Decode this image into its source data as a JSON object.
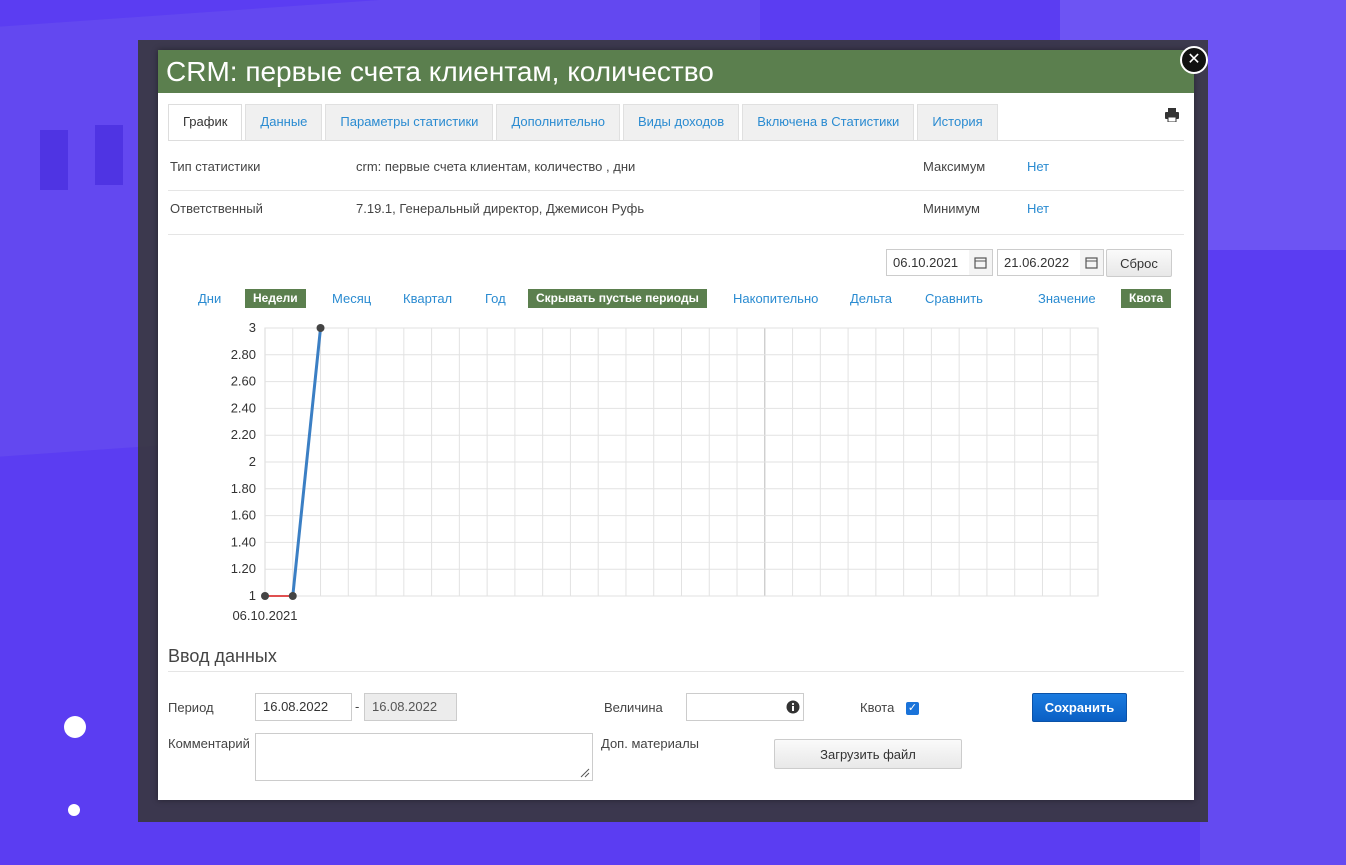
{
  "window": {
    "title": "CRM: первые счета клиентам, количество"
  },
  "tabs": [
    {
      "label": "График",
      "active": true
    },
    {
      "label": "Данные"
    },
    {
      "label": "Параметры статистики"
    },
    {
      "label": "Дополнительно"
    },
    {
      "label": "Виды доходов"
    },
    {
      "label": "Включена в Статистики"
    },
    {
      "label": "История"
    }
  ],
  "icons": {
    "close": "close-icon",
    "print": "printer-icon",
    "calendar": "calendar-icon",
    "info": "info-icon"
  },
  "info": {
    "type_label": "Тип статистики",
    "type_value": "crm: первые счета клиентам, количество , дни",
    "max_label": "Максимум",
    "max_value": "Нет",
    "owner_label": "Ответственный",
    "owner_value": "7.19.1, Генеральный директор, Джемисон Руфь",
    "min_label": "Минимум",
    "min_value": "Нет"
  },
  "range": {
    "from": "06.10.2021",
    "to": "21.06.2022",
    "reset_label": "Сброс"
  },
  "periods": {
    "days": "Дни",
    "weeks": "Недели",
    "month": "Месяц",
    "quarter": "Квартал",
    "year": "Год",
    "hide_empty": "Скрывать пустые периоды",
    "cumulative": "Накопительно",
    "delta": "Дельта",
    "compare": "Сравнить",
    "value": "Значение",
    "quota": "Квота"
  },
  "chart_data": {
    "type": "line",
    "y_ticks": [
      "1",
      "1.20",
      "1.40",
      "1.60",
      "1.80",
      "2",
      "2.20",
      "2.40",
      "2.60",
      "2.80",
      "3"
    ],
    "ylim": [
      1,
      3
    ],
    "x_tick_label": "06.10.2021",
    "grid": true,
    "series": [
      {
        "points": [
          {
            "x": 0,
            "y": 1
          },
          {
            "x": 1,
            "y": 1
          },
          {
            "x": 2,
            "y": 3
          }
        ],
        "color": "#3b7fc4"
      }
    ],
    "quota_series": {
      "points": [
        {
          "x": 0,
          "y": 1
        },
        {
          "x": 1,
          "y": 1
        }
      ],
      "color": "#e05050"
    }
  },
  "entry": {
    "title": "Ввод данных",
    "period_label": "Период",
    "period_from": "16.08.2022",
    "period_dash": "-",
    "period_to": "16.08.2022",
    "value_label": "Величина",
    "value": "",
    "quota_label": "Квота",
    "save_label": "Сохранить",
    "comment_label": "Комментарий",
    "comment": "",
    "extra_label": "Доп. материалы",
    "upload_label": "Загрузить файл"
  }
}
